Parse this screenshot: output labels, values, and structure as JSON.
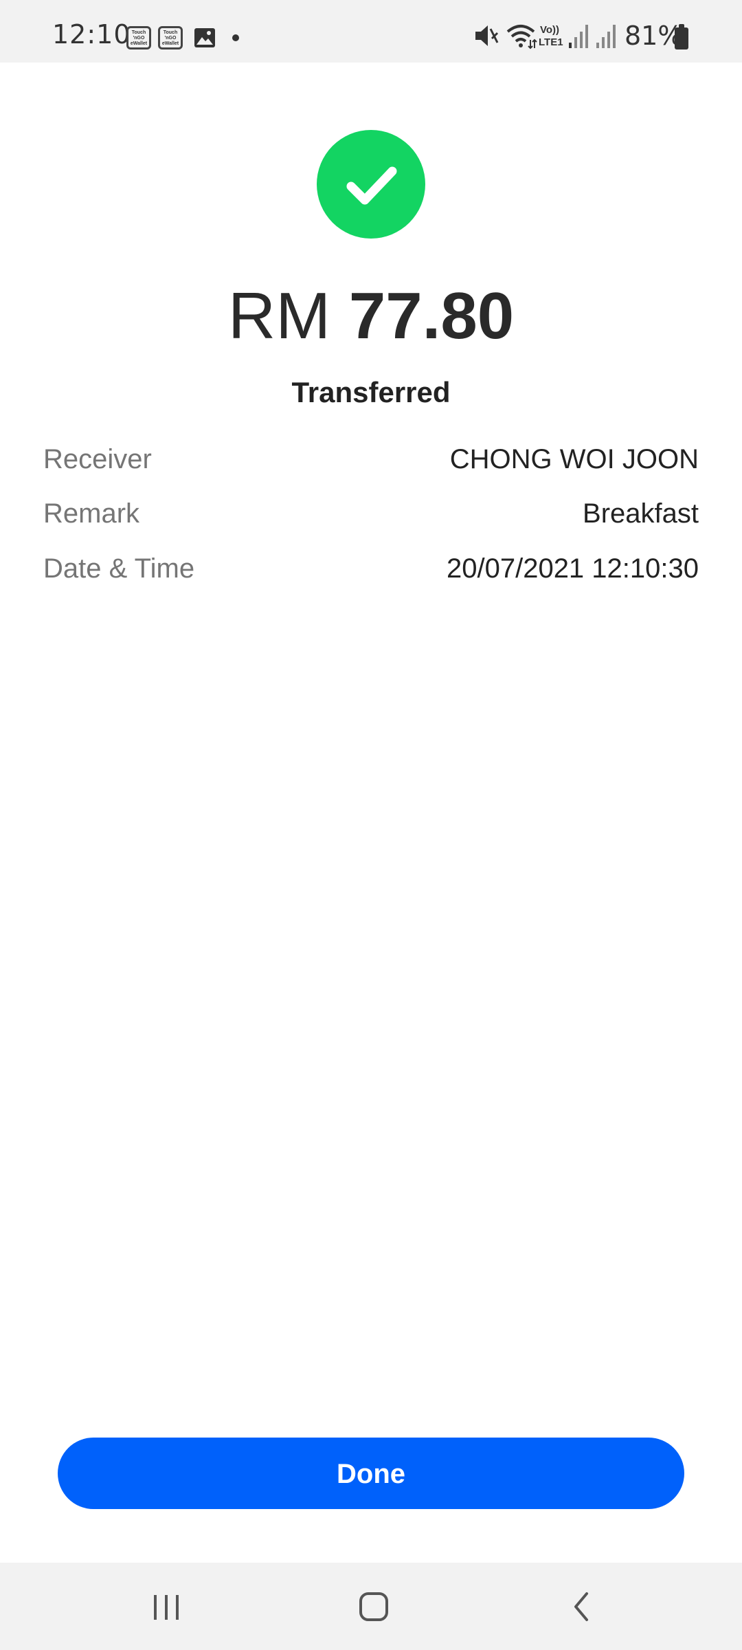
{
  "status_bar": {
    "time": "12:10",
    "notification_badges": [
      "Touch 'n Go eWallet",
      "Touch 'n Go eWallet"
    ],
    "battery": "81%",
    "icons": [
      "tng-ewallet-icon",
      "tng-ewallet-icon",
      "gallery-icon",
      "notification-dot",
      "mute-icon",
      "wifi-icon",
      "volte-icon",
      "signal-icon",
      "signal-icon",
      "battery-icon"
    ]
  },
  "receipt": {
    "currency": "RM",
    "amount": "77.80",
    "status": "Transferred",
    "status_color": "#13d462",
    "details": [
      {
        "label": "Receiver",
        "value": "CHONG WOI JOON"
      },
      {
        "label": "Remark",
        "value": "Breakfast"
      },
      {
        "label": "Date & Time",
        "value": "20/07/2021 12:10:30"
      }
    ]
  },
  "actions": {
    "done_label": "Done",
    "done_color": "#0061fb"
  },
  "nav_bar": {
    "buttons": [
      "recent-apps-icon",
      "home-icon",
      "back-icon"
    ]
  }
}
